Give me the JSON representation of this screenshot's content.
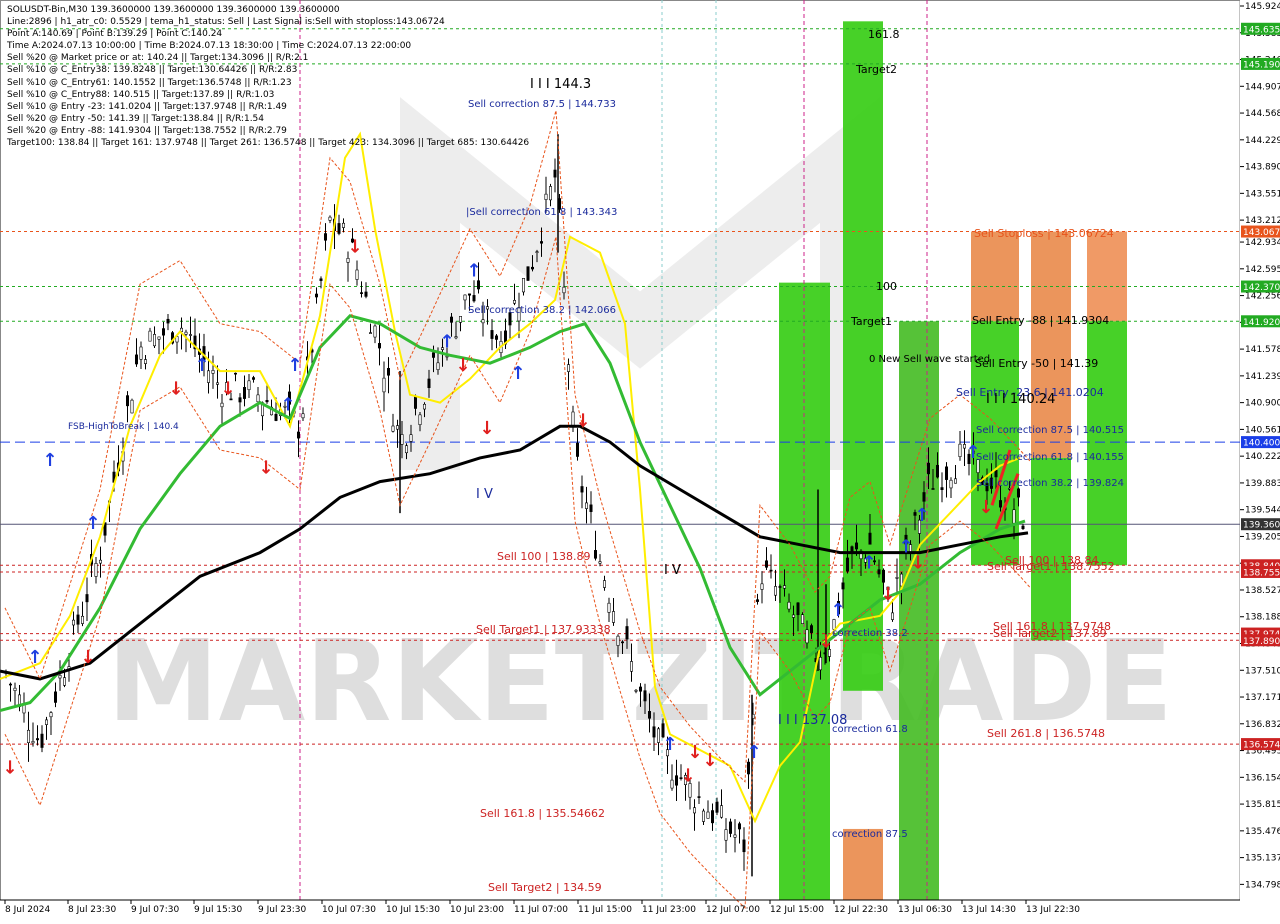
{
  "header": {
    "lines": [
      "SOLUSDT-Bin,M30   139.3600000 139.3600000 139.3600000 139.3600000",
      "Line:2896  |  h1_atr_c0: 0.5529  |  tema_h1_status: Sell  |  Last Signal is:Sell with stoploss:143.06724",
      "Point A:140.69  |  Point B:139.29  |  Point C:140.24",
      "Time A:2024.07.13 10:00:00  |  Time B:2024.07.13 18:30:00  |  Time C:2024.07.13 22:00:00",
      "Sell %20 @ Market price or at: 140.24  ||  Target:134.3096  ||  R/R:2.1",
      "Sell %10 @ C_Entry38: 139.8248  ||  Target:130.64426  ||  R/R:2.83",
      "Sell %10 @ C_Entry61: 140.1552  ||  Target:136.5748  ||  R/R:1.23",
      "Sell %10 @ C_Entry88: 140.515  ||  Target:137.89  ||  R/R:1.03",
      "Sell %10 @ Entry -23: 141.0204  ||  Target:137.9748  ||  R/R:1.49",
      "Sell %20 @ Entry -50: 141.39  ||  Target:138.84  ||  R/R:1.54",
      "Sell %20 @ Entry -88: 141.9304  ||  Target:138.7552  ||  R/R:2.79",
      "Target100: 138.84  ||  Target 161: 137.9748  ||  Target 261: 136.5748  ||  Target 423: 134.3096  ||  Target 685: 130.64426"
    ]
  },
  "watermark": "MARKETZITRADE",
  "chart_data": {
    "type": "candlestick",
    "symbol": "SOLUSDT-Bin",
    "timeframe": "M30",
    "ylim": [
      134.6,
      146.0
    ],
    "y_ticks": [
      "145.924",
      "145.585",
      "145.246",
      "144.907",
      "144.568",
      "144.229",
      "143.890",
      "143.551",
      "143.212",
      "142.934",
      "142.595",
      "142.256",
      "141.917",
      "141.578",
      "141.239",
      "140.900",
      "140.561",
      "140.222",
      "139.883",
      "139.544",
      "139.205",
      "138.866",
      "138.527",
      "138.188",
      "137.849",
      "137.510",
      "137.171",
      "136.832",
      "136.493",
      "136.154",
      "135.815",
      "135.476",
      "135.137",
      "134.798"
    ],
    "x_ticks": [
      "8 Jul 2024",
      "8 Jul 23:30",
      "9 Jul 07:30",
      "9 Jul 15:30",
      "9 Jul 23:30",
      "10 Jul 07:30",
      "10 Jul 15:30",
      "10 Jul 23:00",
      "11 Jul 07:00",
      "11 Jul 15:00",
      "11 Jul 23:00",
      "12 Jul 07:00",
      "12 Jul 15:00",
      "12 Jul 22:30",
      "13 Jul 06:30",
      "13 Jul 14:30",
      "13 Jul 22:30"
    ],
    "price_tags": [
      {
        "value": 145.6356,
        "label": "145.635",
        "color": "#22aa22"
      },
      {
        "value": 145.1904,
        "label": "145.190",
        "color": "#22aa22"
      },
      {
        "value": 143.0672,
        "label": "143.067",
        "color": "#e8541c"
      },
      {
        "value": 142.3706,
        "label": "142.370",
        "color": "#22aa22"
      },
      {
        "value": 141.9304,
        "label": "141.920",
        "color": "#22aa22"
      },
      {
        "value": 140.4,
        "label": "140.400",
        "color": "#1a3ee8"
      },
      {
        "value": 139.36,
        "label": "139.360",
        "color": "#333333"
      },
      {
        "value": 138.84,
        "label": "138.840",
        "color": "#cc2222"
      },
      {
        "value": 138.7552,
        "label": "138.755",
        "color": "#cc2222"
      },
      {
        "value": 137.9748,
        "label": "137.974",
        "color": "#cc2222"
      },
      {
        "value": 137.89,
        "label": "137.890",
        "color": "#cc2222"
      },
      {
        "value": 136.5748,
        "label": "136.574",
        "color": "#cc2222"
      }
    ],
    "horizontal_lines": [
      {
        "value": 145.6356,
        "color": "#22aa22",
        "style": "dotted"
      },
      {
        "value": 145.1904,
        "color": "#22aa22",
        "style": "dotted"
      },
      {
        "value": 143.0672,
        "color": "#e8541c",
        "style": "dotted"
      },
      {
        "value": 142.3706,
        "color": "#22aa22",
        "style": "dotted"
      },
      {
        "value": 141.9304,
        "color": "#22aa22",
        "style": "dotted"
      },
      {
        "value": 140.4,
        "color": "#1a3ee8",
        "style": "dashed"
      },
      {
        "value": 139.36,
        "color": "#555577",
        "style": "solid"
      },
      {
        "value": 138.84,
        "color": "#cc2222",
        "style": "dotted"
      },
      {
        "value": 138.7552,
        "color": "#cc2222",
        "style": "dotted"
      },
      {
        "value": 137.9748,
        "color": "#cc2222",
        "style": "dotted"
      },
      {
        "value": 137.89,
        "color": "#cc2222",
        "style": "dotted"
      },
      {
        "value": 136.5748,
        "color": "#cc2222",
        "style": "dotted"
      }
    ],
    "annotations": [
      {
        "text": "I I I 144.3",
        "color": "#000000"
      },
      {
        "text": "Sell correction 87.5 | 144.733",
        "color": "#1a2a9c"
      },
      {
        "text": "|Sell correction 61.8 | 143.343",
        "color": "#1a2a9c"
      },
      {
        "text": "Sell correction 38.2 | 142.066",
        "color": "#1a2a9c"
      },
      {
        "text": "FSB-HighToBreak | 140.4",
        "color": "#1a2a9c"
      },
      {
        "text": "I V",
        "color": "#1a2a9c"
      },
      {
        "text": "I V",
        "color": "#000000"
      },
      {
        "text": "Sell 100 | 138.89",
        "color": "#cc2222"
      },
      {
        "text": "Sell Target1 | 137.93338",
        "color": "#cc2222"
      },
      {
        "text": "Sell 161.8 | 135.54662",
        "color": "#cc2222"
      },
      {
        "text": "Sell Target2 | 134.59",
        "color": "#cc2222"
      },
      {
        "text": "I I I 137.08",
        "color": "#1a2a9c"
      },
      {
        "text": "correction 38.2",
        "color": "#1a2a9c"
      },
      {
        "text": "correction 61.8",
        "color": "#1a2a9c"
      },
      {
        "text": "correction 87.5",
        "color": "#1a2a9c"
      },
      {
        "text": "161.8",
        "color": "#000000"
      },
      {
        "text": "Target2",
        "color": "#000000"
      },
      {
        "text": "100",
        "color": "#000000"
      },
      {
        "text": "Target1",
        "color": "#000000"
      },
      {
        "text": "0 New Sell wave started",
        "color": "#000000"
      },
      {
        "text": "Sell Stoploss | 143.06724",
        "color": "#e8541c"
      },
      {
        "text": "Sell Entry -88 | 141.9304",
        "color": "#000000"
      },
      {
        "text": "Sell Entry -50 | 141.39",
        "color": "#000000"
      },
      {
        "text": "Sell Entry -23.6 | 141.0204",
        "color": "#1a2a9c"
      },
      {
        "text": "I I I 140.24",
        "color": "#000000"
      },
      {
        "text": "Sell correction 87.5 | 140.515",
        "color": "#1a2a9c"
      },
      {
        "text": "Sell correction 61.8 | 140.155",
        "color": "#1a2a9c"
      },
      {
        "text": "Sell correction 38.2 | 139.824",
        "color": "#1a2a9c"
      },
      {
        "text": "Sell 100 | 138.84",
        "color": "#cc2222"
      },
      {
        "text": "Sell Target1 | 138.7552",
        "color": "#cc2222"
      },
      {
        "text": "Sell 161.8 | 137.9748",
        "color": "#cc2222"
      },
      {
        "text": "Sell Target2 | 137.89",
        "color": "#cc2222"
      },
      {
        "text": "Sell 261.8 | 136.5748",
        "color": "#cc2222"
      }
    ],
    "colors": {
      "ma_fast": "#ffee00",
      "ma_mid": "#33bb33",
      "ma_slow": "#000000",
      "envelope": "#e8541c",
      "bull": "#000000",
      "bear": "#000000",
      "green_zone": "#33cc11",
      "orange_zone": "#e98a4a"
    }
  }
}
